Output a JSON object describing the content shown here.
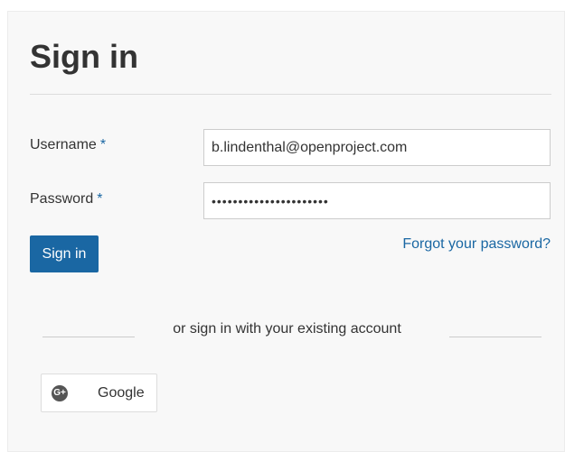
{
  "page": {
    "title": "Sign in"
  },
  "form": {
    "username_label": "Username",
    "password_label": "Password",
    "required_marker": "*",
    "username_value": "b.lindenthal@openproject.com",
    "password_value": "••••••••••••••••••••••",
    "submit_label": "Sign in",
    "forgot_label": "Forgot your password?"
  },
  "alt_login": {
    "divider_text": "or sign in with your existing account",
    "providers": [
      {
        "label": "Google",
        "icon": "google-plus-icon",
        "glyph": "G+"
      }
    ]
  },
  "colors": {
    "accent": "#1a67a3",
    "panel_bg": "#f8f8f8",
    "text": "#333333"
  }
}
